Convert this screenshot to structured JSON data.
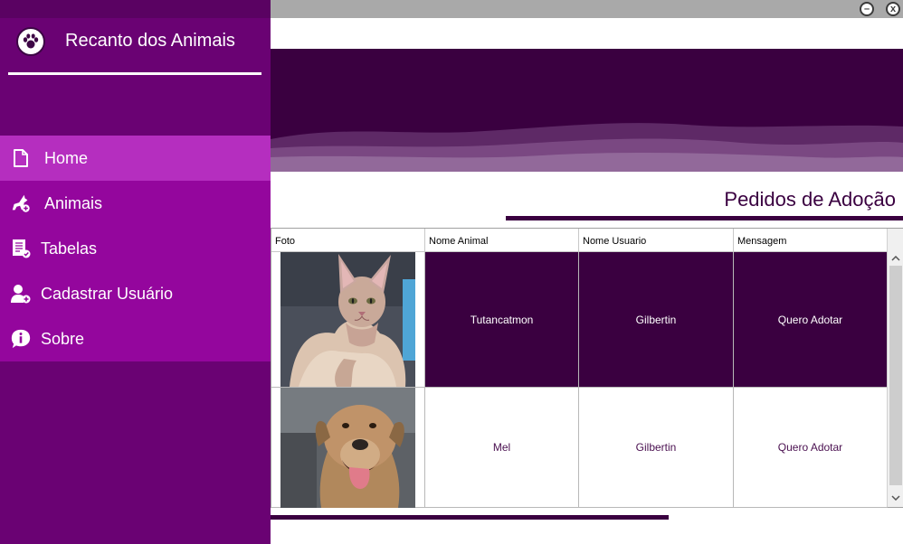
{
  "sidebar": {
    "app_title": "Recanto dos Animais",
    "logo_icon": "paw-icon",
    "items": [
      {
        "label": "Home",
        "icon": "file-icon",
        "active": true
      },
      {
        "label": "Animais",
        "icon": "dog-add-icon",
        "active": false
      },
      {
        "label": "Tabelas",
        "icon": "table-check-icon",
        "active": false
      },
      {
        "label": "Cadastrar Usuário",
        "icon": "user-add-icon",
        "active": false
      },
      {
        "label": "Sobre",
        "icon": "info-icon",
        "active": false
      }
    ]
  },
  "window": {
    "minimize_label": "–",
    "close_label": "x"
  },
  "main": {
    "section_title": "Pedidos de Adoção",
    "table": {
      "headers": [
        "Foto",
        "Nome Animal",
        "Nome Usuario",
        "Mensagem"
      ],
      "rows": [
        {
          "photo": "sphynx-cat-photo",
          "animal": "Tutancatmon",
          "user": "Gilbertin",
          "message": "Quero Adotar",
          "selected": true
        },
        {
          "photo": "brown-dog-photo",
          "animal": "Mel",
          "user": "Gilbertin",
          "message": "Quero Adotar",
          "selected": false
        }
      ]
    }
  },
  "colors": {
    "sidebar_bg": "#6a0273",
    "nav_bg": "#94069d",
    "nav_active": "#b52ebf",
    "accent_dark": "#3a0040",
    "topbar": "#a9a9a9"
  }
}
